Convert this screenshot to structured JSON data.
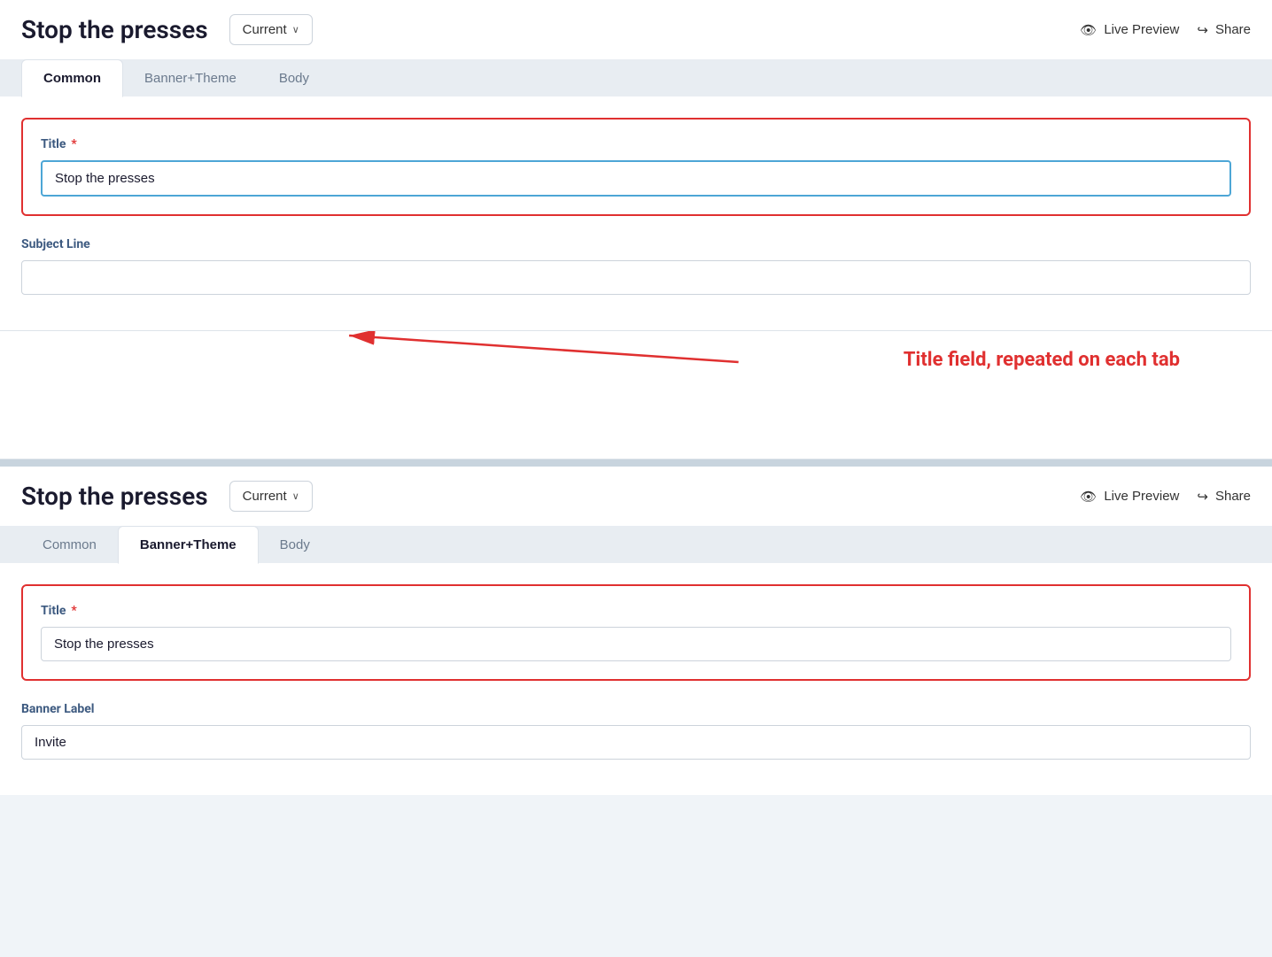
{
  "top": {
    "title": "Stop the presses",
    "version_dropdown": {
      "label": "Current",
      "chevron": "∨"
    },
    "live_preview_label": "Live Preview",
    "share_label": "Share",
    "tabs": [
      {
        "id": "common",
        "label": "Common",
        "active": true
      },
      {
        "id": "banner_theme",
        "label": "Banner+Theme",
        "active": false
      },
      {
        "id": "body",
        "label": "Body",
        "active": false
      }
    ],
    "form": {
      "title_label": "Title",
      "title_required": "*",
      "title_value": "Stop the presses",
      "subject_line_label": "Subject Line",
      "subject_line_value": ""
    }
  },
  "annotation": {
    "text": "Title field, repeated on each tab"
  },
  "bottom": {
    "title": "Stop the presses",
    "version_dropdown": {
      "label": "Current",
      "chevron": "∨"
    },
    "live_preview_label": "Live Preview",
    "share_label": "Share",
    "tabs": [
      {
        "id": "common",
        "label": "Common",
        "active": false
      },
      {
        "id": "banner_theme",
        "label": "Banner+Theme",
        "active": true
      },
      {
        "id": "body",
        "label": "Body",
        "active": false
      }
    ],
    "form": {
      "title_label": "Title",
      "title_required": "*",
      "title_value": "Stop the presses",
      "banner_label_label": "Banner Label",
      "banner_label_value": "Invite"
    }
  },
  "icons": {
    "eye": "👁",
    "share": "↪",
    "chevron": "∨"
  }
}
